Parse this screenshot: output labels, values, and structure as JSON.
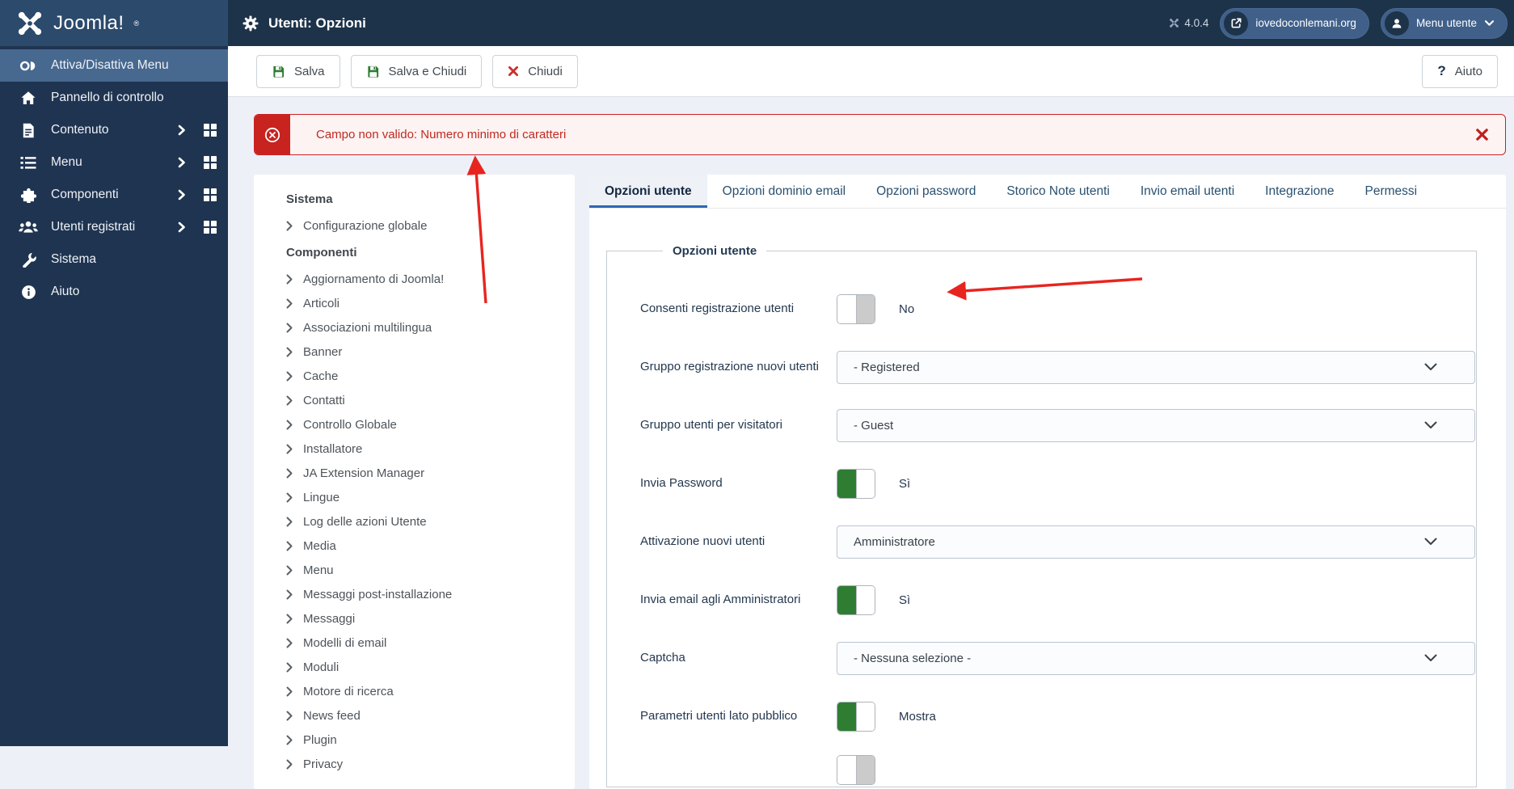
{
  "topbar": {
    "logo_text": "Joomla!",
    "logo_mark": "®",
    "page_title": "Utenti: Opzioni",
    "version": "4.0.4",
    "site_link": "iovedoconlemani.org",
    "user_menu": "Menu utente"
  },
  "sidebar": {
    "items": [
      {
        "label": "Attiva/Disattiva Menu",
        "icon": "toggle-icon",
        "active": true,
        "expandable": false
      },
      {
        "label": "Pannello di controllo",
        "icon": "home-icon",
        "active": false,
        "expandable": false
      },
      {
        "label": "Contenuto",
        "icon": "document-icon",
        "active": false,
        "expandable": true
      },
      {
        "label": "Menu",
        "icon": "list-icon",
        "active": false,
        "expandable": true
      },
      {
        "label": "Componenti",
        "icon": "puzzle-icon",
        "active": false,
        "expandable": true
      },
      {
        "label": "Utenti registrati",
        "icon": "users-icon",
        "active": false,
        "expandable": true
      },
      {
        "label": "Sistema",
        "icon": "wrench-icon",
        "active": false,
        "expandable": false
      },
      {
        "label": "Aiuto",
        "icon": "info-icon",
        "active": false,
        "expandable": false
      }
    ]
  },
  "toolbar": {
    "save_label": "Salva",
    "save_close_label": "Salva e Chiudi",
    "close_label": "Chiudi",
    "help_label": "Aiuto"
  },
  "alert": {
    "message": "Campo non valido: Numero minimo di caratteri"
  },
  "tree": {
    "groups": [
      {
        "header": "Sistema",
        "items": [
          "Configurazione globale"
        ]
      },
      {
        "header": "Componenti",
        "items": [
          "Aggiornamento di Joomla!",
          "Articoli",
          "Associazioni multilingua",
          "Banner",
          "Cache",
          "Contatti",
          "Controllo Globale",
          "Installatore",
          "JA Extension Manager",
          "Lingue",
          "Log delle azioni Utente",
          "Media",
          "Menu",
          "Messaggi post-installazione",
          "Messaggi",
          "Modelli di email",
          "Moduli",
          "Motore di ricerca",
          "News feed",
          "Plugin",
          "Privacy"
        ]
      }
    ]
  },
  "tabs": [
    "Opzioni utente",
    "Opzioni dominio email",
    "Opzioni password",
    "Storico Note utenti",
    "Invio email utenti",
    "Integrazione",
    "Permessi"
  ],
  "active_tab": 0,
  "panel": {
    "legend": "Opzioni utente",
    "fields": [
      {
        "label": "Consenti registrazione utenti",
        "type": "toggle",
        "state": "off",
        "value": "No"
      },
      {
        "label": "Gruppo registrazione nuovi utenti",
        "type": "select",
        "value": "- Registered"
      },
      {
        "label": "Gruppo utenti per visitatori",
        "type": "select",
        "value": "- Guest"
      },
      {
        "label": "Invia Password",
        "type": "toggle",
        "state": "on",
        "value": "Sì"
      },
      {
        "label": "Attivazione nuovi utenti",
        "type": "select",
        "value": "Amministratore"
      },
      {
        "label": "Invia email agli Amministratori",
        "type": "toggle",
        "state": "on",
        "value": "Sì"
      },
      {
        "label": "Captcha",
        "type": "select",
        "value": "- Nessuna selezione -"
      },
      {
        "label": "Parametri utenti lato pubblico",
        "type": "toggle",
        "state": "on",
        "value": "Mostra"
      },
      {
        "label": "",
        "type": "toggle-partial",
        "state": "off",
        "value": ""
      }
    ]
  },
  "colors": {
    "topbar": "#1d3349",
    "logo_block": "#2c4a6b",
    "sidebar": "#1f3450",
    "sidebar_active": "#47688f",
    "accent_blue": "#2c68b4",
    "joomla_green": "#2e7d32",
    "error_red": "#cb2025",
    "annotation_red": "#e8241f",
    "page_bg": "#edf1f7"
  }
}
